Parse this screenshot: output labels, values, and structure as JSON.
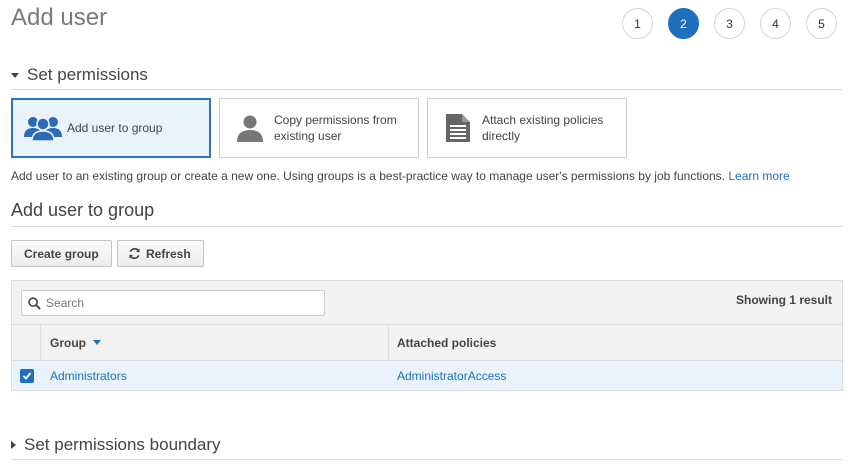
{
  "header": {
    "title": "Add user"
  },
  "steps": {
    "items": [
      "1",
      "2",
      "3",
      "4",
      "5"
    ],
    "active_index": 1
  },
  "permissions": {
    "heading": "Set permissions",
    "options": [
      {
        "label": "Add user to group",
        "icon": "users-group-icon",
        "selected": true
      },
      {
        "label": "Copy permissions from existing user",
        "icon": "user-icon",
        "selected": false
      },
      {
        "label": "Attach existing policies directly",
        "icon": "document-icon",
        "selected": false
      }
    ],
    "help_text": "Add user to an existing group or create a new one. Using groups is a best-practice way to manage user's permissions by job functions.",
    "learn_more": "Learn more"
  },
  "group_section": {
    "heading": "Add user to group",
    "create_button": "Create group",
    "refresh_button": "Refresh"
  },
  "table": {
    "search_placeholder": "Search",
    "result_count": "Showing 1 result",
    "columns": [
      "Group",
      "Attached policies"
    ],
    "rows": [
      {
        "checked": true,
        "group": "Administrators",
        "policies": "AdministratorAccess"
      }
    ]
  },
  "boundary": {
    "heading": "Set permissions boundary"
  },
  "colors": {
    "accent": "#1f6fbf",
    "selected_bg": "#eaf3fb",
    "row_bg": "#e9f3fb"
  }
}
